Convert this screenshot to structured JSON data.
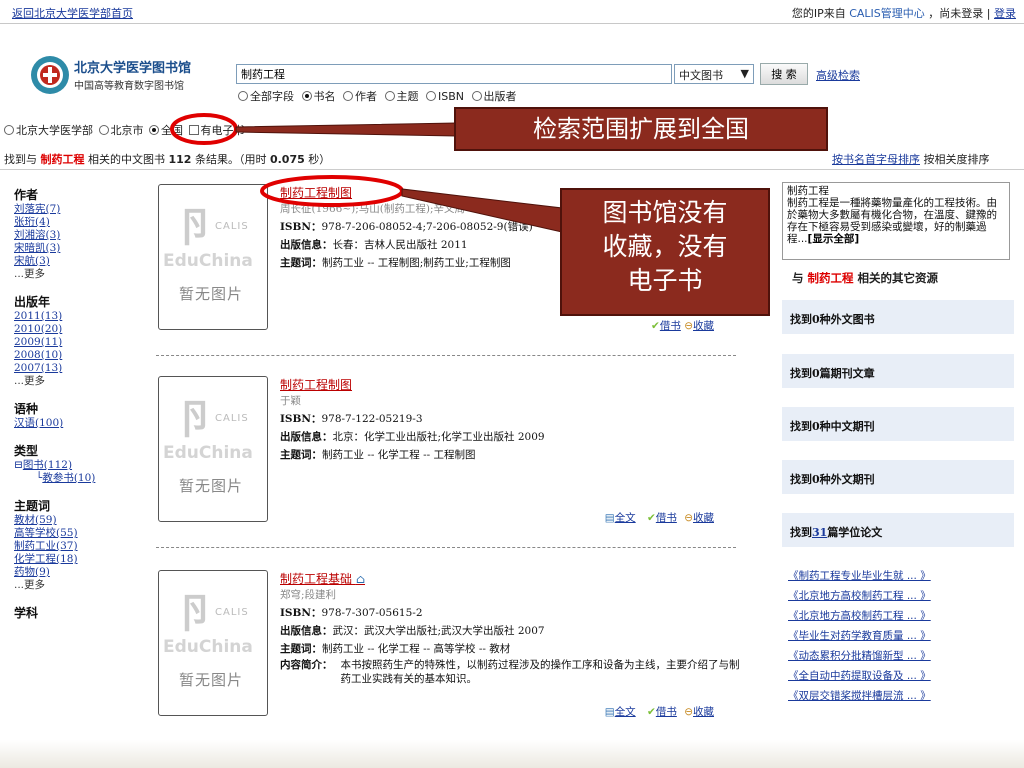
{
  "topbar": {
    "back_link": "返回北京大学医学部首页",
    "ip_prefix": "您的IP来自",
    "ip_source": "CALIS管理中心",
    "status": "，尚未登录",
    "separator": "|",
    "login": "登录"
  },
  "logo": {
    "name": "北京大学医学图书馆",
    "subtitle": "中国高等教育数字图书馆"
  },
  "search": {
    "query": "制药工程",
    "type_selected": "中文图书",
    "submit_label": "搜 索",
    "advanced_label": "高级检索",
    "fields": [
      {
        "label": "全部字段",
        "checked": false
      },
      {
        "label": "书名",
        "checked": true
      },
      {
        "label": "作者",
        "checked": false
      },
      {
        "label": "主题",
        "checked": false
      },
      {
        "label": "ISBN",
        "checked": false
      },
      {
        "label": "出版者",
        "checked": false
      }
    ]
  },
  "scope": {
    "options": [
      {
        "label": "北京大学医学部",
        "checked": false
      },
      {
        "label": "北京市",
        "checked": false
      },
      {
        "label": "全国",
        "checked": true
      }
    ],
    "ebook_label": "有电子书"
  },
  "summary": {
    "prefix": "找到与",
    "keyword": "制药工程",
    "middle": "相关的中文图书",
    "count": "112",
    "suffix": "条结果。（用时",
    "time": "0.075",
    "time_unit": "秒）",
    "sort_by_title": "按书名首字母排序",
    "sort_by_relevance": "按相关度排序"
  },
  "facets": {
    "author": {
      "title": "作者",
      "items": [
        "刘落宪(7)",
        "张珩(4)",
        "刘湘溶(3)",
        "宋暗凯(3)",
        "宋航(3)"
      ],
      "more": "...更多"
    },
    "year": {
      "title": "出版年",
      "items": [
        "2011(13)",
        "2010(20)",
        "2009(11)",
        "2008(10)",
        "2007(13)"
      ],
      "more": "...更多"
    },
    "language": {
      "title": "语种",
      "items": [
        "汉语(100)"
      ]
    },
    "type": {
      "title": "类型",
      "root": "图书(112)",
      "child": "教参书(10)"
    },
    "subject": {
      "title": "主题词",
      "items": [
        "教材(59)",
        "高等学校(55)",
        "制药工业(37)",
        "化学工程(18)",
        "药物(9)"
      ],
      "more": "...更多"
    },
    "discipline": {
      "title": "学科"
    }
  },
  "thumb": {
    "calis": "CALIS",
    "edu": "EduChina",
    "noimg": "暂无图片"
  },
  "labels": {
    "isbn": "ISBN：",
    "pubinfo": "出版信息：",
    "subject": "主题词：",
    "summary": "内容简介："
  },
  "actions": {
    "fulltext": "全文",
    "borrow": "借书",
    "favorite": "收藏"
  },
  "records": [
    {
      "title": "制药工程制图",
      "authors": "周长征(1966~);马山(制药工程);辛义周",
      "isbn": "978-7-206-08052-4;7-206-08052-9(错误)",
      "pubinfo": "长春：吉林人民出版社 2011",
      "subject": "制药工业 -- 工程制图;制药工业;工程制图"
    },
    {
      "title": "制药工程制图",
      "authors": "于颖",
      "isbn": "978-7-122-05219-3",
      "pubinfo": "北京：化学工业出版社;化学工业出版社 2009",
      "subject": "制药工业 -- 化学工程 -- 工程制图"
    },
    {
      "title": "制药工程基础",
      "authors": "郑穹;段建利",
      "isbn": "978-7-307-05615-2",
      "pubinfo": "武汉：武汉大学出版社;武汉大学出版社 2007",
      "subject": "制药工业 -- 化学工程 -- 高等学校 -- 教材",
      "summary": "本书按照药生产的特殊性，以制药过程涉及的操作工序和设备为主线，主要介绍了与制药工业实践有关的基本知识。"
    }
  ],
  "sidebar": {
    "wiki": {
      "term": "制药工程",
      "text": "制药工程是一種將藥物量產化的工程技術。由於藥物大多數屬有機化合物，在溫度、鍵豫的存在下極容易受到感染或變壞，好的制藥過程...",
      "show_all": "[显示全部]"
    },
    "other_header": {
      "prefix": "与",
      "keyword": "制药工程",
      "suffix": "相关的其它资源"
    },
    "blocks": [
      {
        "prefix": "找到",
        "count": "0",
        "suffix": "种外文图书"
      },
      {
        "prefix": "找到",
        "count": "0",
        "suffix": "篇期刊文章"
      },
      {
        "prefix": "找到",
        "count": "0",
        "suffix": "种中文期刊"
      },
      {
        "prefix": "找到",
        "count": "0",
        "suffix": "种外文期刊"
      },
      {
        "prefix": "找到",
        "count": "31",
        "suffix": "篇学位论文"
      }
    ],
    "thesis_links": [
      "《制药工程专业毕业生就 ... 》",
      "《北京地方高校制药工程 ... 》",
      "《北京地方高校制药工程 ... 》",
      "《毕业生对药学教育质量 ... 》",
      "《动态累积分批精馏新型 ... 》",
      "《全自动中药提取设备及 ... 》",
      "《双层交错桨搅拌槽层流 ... 》"
    ]
  },
  "annotations": {
    "scope_note": "检索范围扩展到全国",
    "holding_note_lines": [
      "图书馆没有",
      "收藏，没有",
      "电子书"
    ],
    "color": "#8b2a1e",
    "ring_color": "#e00000"
  }
}
